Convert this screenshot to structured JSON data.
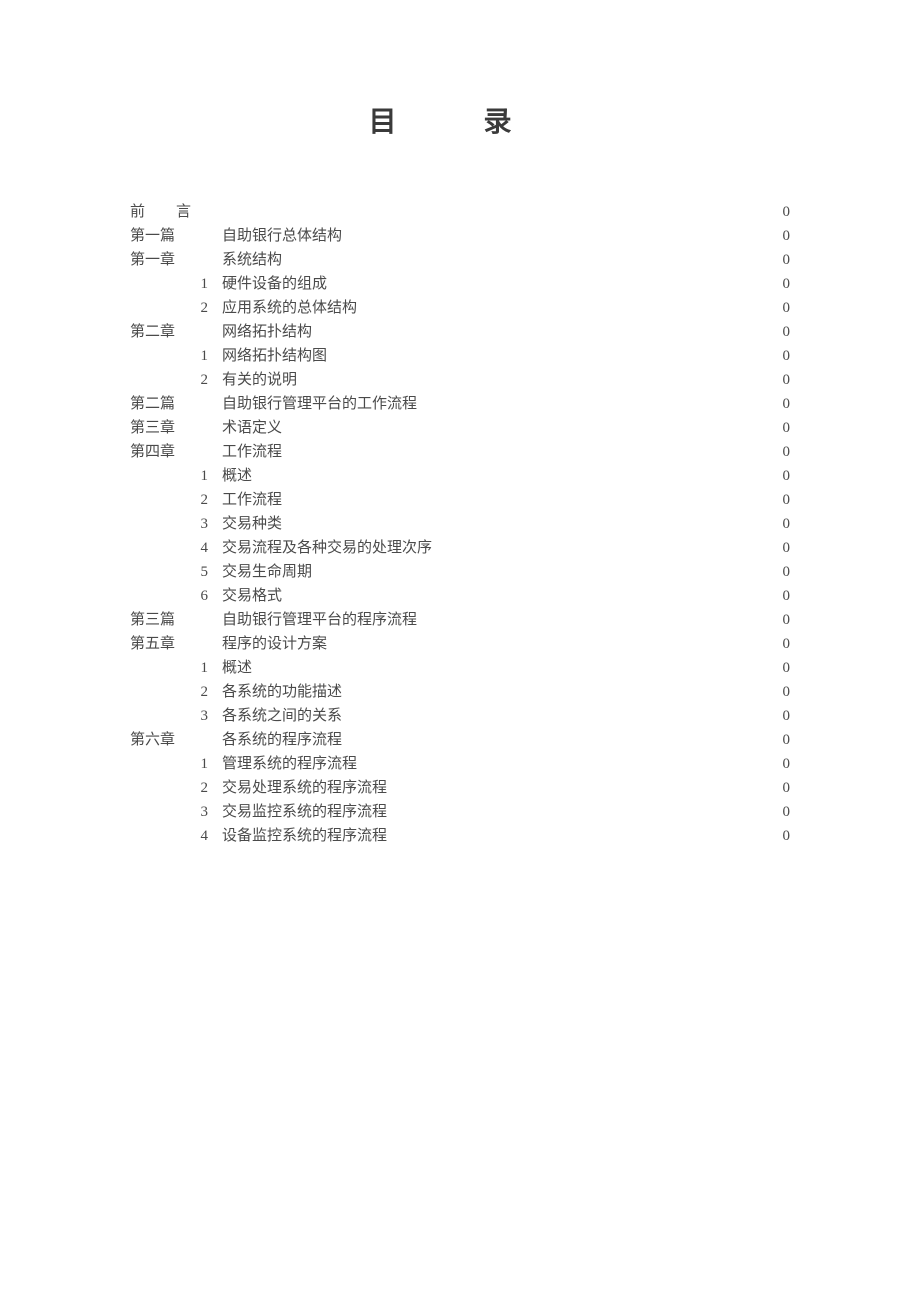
{
  "title": "目    录",
  "entries": [
    {
      "level": "前",
      "num": "言",
      "text": "",
      "page": "0",
      "preface": true
    },
    {
      "level": "第一篇",
      "num": "",
      "text": "自助银行总体结构",
      "page": "0"
    },
    {
      "level": "第一章",
      "num": "",
      "text": "系统结构",
      "page": "0"
    },
    {
      "level": "",
      "num": "1",
      "text": "硬件设备的组成",
      "page": "0"
    },
    {
      "level": "",
      "num": "2",
      "text": "应用系统的总体结构",
      "page": "0"
    },
    {
      "level": "第二章",
      "num": "",
      "text": "网络拓扑结构",
      "page": "0"
    },
    {
      "level": "",
      "num": "1",
      "text": "网络拓扑结构图",
      "page": "0"
    },
    {
      "level": "",
      "num": "2",
      "text": "有关的说明",
      "page": "0"
    },
    {
      "level": "第二篇",
      "num": "",
      "text": "自助银行管理平台的工作流程",
      "page": "0"
    },
    {
      "level": "第三章",
      "num": "",
      "text": "术语定义",
      "page": "0"
    },
    {
      "level": "第四章",
      "num": "",
      "text": "工作流程",
      "page": "0"
    },
    {
      "level": "",
      "num": "1",
      "text": "概述",
      "page": "0"
    },
    {
      "level": "",
      "num": "2",
      "text": "工作流程",
      "page": "0"
    },
    {
      "level": "",
      "num": "3",
      "text": "交易种类",
      "page": "0"
    },
    {
      "level": "",
      "num": "4",
      "text": "交易流程及各种交易的处理次序",
      "page": "0"
    },
    {
      "level": "",
      "num": "5",
      "text": "交易生命周期",
      "page": "0"
    },
    {
      "level": "",
      "num": "6",
      "text": "交易格式",
      "page": "0"
    },
    {
      "level": "第三篇",
      "num": "",
      "text": "自助银行管理平台的程序流程",
      "page": "0"
    },
    {
      "level": "第五章",
      "num": "",
      "text": "程序的设计方案",
      "page": "0"
    },
    {
      "level": "",
      "num": "1",
      "text": "概述",
      "page": "0"
    },
    {
      "level": "",
      "num": "2",
      "text": "各系统的功能描述",
      "page": "0"
    },
    {
      "level": "",
      "num": "3",
      "text": "各系统之间的关系",
      "page": "0"
    },
    {
      "level": "第六章",
      "num": "",
      "text": "各系统的程序流程",
      "page": "0"
    },
    {
      "level": "",
      "num": "1",
      "text": "管理系统的程序流程",
      "page": "0"
    },
    {
      "level": "",
      "num": "2",
      "text": "交易处理系统的程序流程",
      "page": "0"
    },
    {
      "level": "",
      "num": "3",
      "text": "交易监控系统的程序流程",
      "page": "0"
    },
    {
      "level": "",
      "num": "4",
      "text": "设备监控系统的程序流程",
      "page": "0"
    }
  ]
}
